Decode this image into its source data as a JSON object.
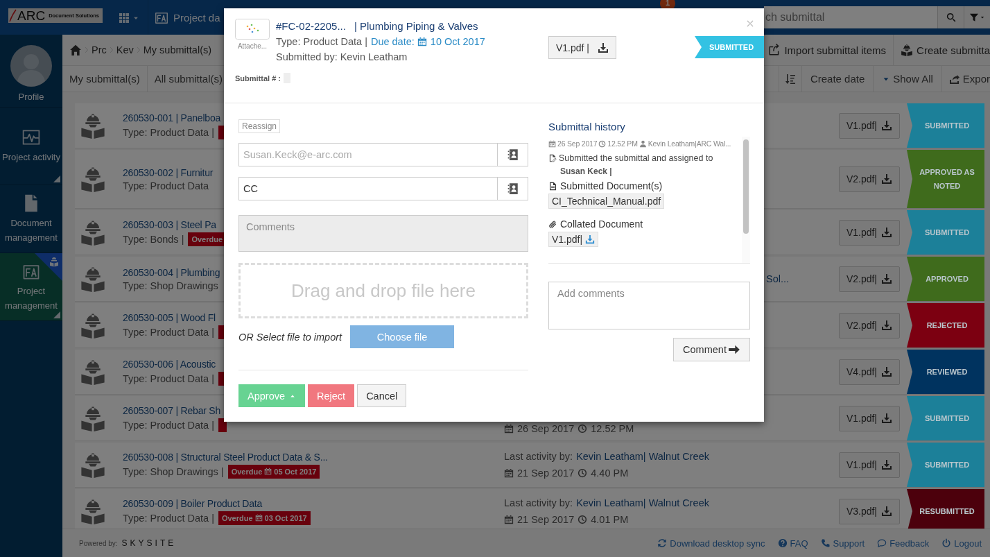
{
  "topbar": {
    "logo": {
      "mark": "ARC",
      "text": "Document Solutions"
    },
    "project_tab": "Project da",
    "notification_count": "1",
    "search": {
      "placeholder": "ch submittal"
    }
  },
  "sidebar": {
    "items": [
      {
        "kind": "profile",
        "label": "Profile",
        "selected": false,
        "expandable": false,
        "badge": false
      },
      {
        "kind": "activity",
        "label": "Project activity",
        "selected": false,
        "expandable": true,
        "badge": false
      },
      {
        "kind": "document",
        "label": "Document management",
        "selected": false,
        "expandable": false,
        "badge": false
      },
      {
        "kind": "project",
        "label": "Project management",
        "selected": true,
        "expandable": true,
        "badge": true
      }
    ]
  },
  "breadcrumb": [
    "Prc",
    "Kev",
    "My submittal(s)"
  ],
  "actions": [
    {
      "kind": "import",
      "label": "Import submittal items"
    },
    {
      "kind": "create",
      "label": "Create submitta"
    }
  ],
  "tabs": [
    {
      "label": "My submittal(s)",
      "selected": false
    },
    {
      "label": "All submittal(s)",
      "selected": false
    }
  ],
  "list_tools": {
    "sort": "Create date",
    "filter": "Show All",
    "export": "Expor"
  },
  "rows": [
    {
      "title": "260530-001 | Panelboa",
      "type": "Type: Product Data |",
      "badge": {},
      "file": "V1.pdf|",
      "status": {
        "label": "SUBMITTED",
        "color": "#1c8099"
      }
    },
    {
      "title": "260530-002 | Furnitur",
      "type": "Type: Product Data",
      "file": "V2.pdf|",
      "status": {
        "label": "APPROVED AS NOTED",
        "color": "#3f6b1c"
      }
    },
    {
      "title": "260530-003 | Steel Pa",
      "type": "Type: Bonds |",
      "badge": {
        "label": "Overdue"
      },
      "file": "V1.pdf|",
      "status": {
        "label": "SUBMITTED",
        "color": "#1c8099"
      }
    },
    {
      "title": "260530-004 | Plumbing",
      "type": "Type: Shop Drawings",
      "activity": {
        "tail": "Sol..."
      },
      "file": "V2.pdf|",
      "status": {
        "label": "APPROVED",
        "color": "#3f6b1c"
      }
    },
    {
      "title": "260530-005 | Wood Fl",
      "type": "Type: Product Data |",
      "badge": {},
      "file": "V2.pdf|",
      "status": {
        "label": "REJECTED",
        "color": "#7c0011"
      }
    },
    {
      "title": "260530-006 | Acoustic",
      "type": "Type: Product Data |",
      "badge": {},
      "file": "V4.pdf|",
      "status": {
        "label": "REVIEWED",
        "color": "#00335f"
      }
    },
    {
      "title": "260530-007 | Rebar Sh",
      "type": "Type: Product Data |",
      "badge": {},
      "activity": {
        "date": "26 Sep 2017",
        "time": "12.52 PM"
      },
      "file": "V1.pdf|",
      "status": {
        "label": "SUBMITTED",
        "color": "#1c8099"
      }
    },
    {
      "title": "260530-008 | Structural Steel Product Data & S...",
      "type": "Type: Shop Drawings |",
      "badge": {
        "label": "Overdue",
        "date": "05 Oct 2017"
      },
      "activity": {
        "label": "Last activity by:",
        "user": "Kevin Leatham| Walnut Creek",
        "date": "21 Sep 2017",
        "time": "4.40 PM"
      },
      "file": "V1.pdf|",
      "status": {
        "label": "SUBMITTED",
        "color": "#1c8099"
      }
    },
    {
      "title": "260530-009 | Boiler Product Data",
      "type": "Type: Product Data |",
      "badge": {
        "label": "Overdue",
        "date": "03 Oct 2017"
      },
      "activity": {
        "label": "Last activity by:",
        "user": "Kevin Leatham| Walnut Creek",
        "date": "21 Sep 2017",
        "time": "4.01 PM"
      },
      "file": "V3.pdf|",
      "status": {
        "label": "RESUBMITTED",
        "color": "#4c000c"
      }
    }
  ],
  "footer": {
    "powered_by": "Powered by:",
    "brand": "SKYSITE",
    "links": [
      {
        "kind": "sync",
        "label": "Download desktop sync"
      },
      {
        "kind": "faq",
        "label": "FAQ"
      },
      {
        "kind": "support",
        "label": "Support"
      },
      {
        "kind": "feedback",
        "label": "Feedback"
      },
      {
        "kind": "logout",
        "label": "Logout"
      }
    ]
  },
  "dialog": {
    "thumbnail_caption": "Attache...",
    "number": "#FC-02-2205...",
    "title": "| Plumbing Piping & Valves",
    "type": "Type: Product Data |",
    "due_label": "Due date:",
    "due_date": "10 Oct 2017",
    "submitted_by": "Submitted by: Kevin Leatham",
    "file": "V1.pdf |",
    "status": {
      "label": "SUBMITTED",
      "color": "#33c2e3"
    },
    "submittal_number_label": "Submittal # :",
    "reassign_label": "Reassign",
    "assignee": {
      "placeholder": "Susan.Keck@e-arc.com"
    },
    "cc": {
      "value": "CC"
    },
    "comments": {
      "placeholder": "Comments"
    },
    "dropzone": "Drag and drop file here",
    "select_label": "OR Select file to import",
    "choose_button": "Choose file",
    "buttons": [
      {
        "kind": "approve",
        "label": "Approve"
      },
      {
        "kind": "reject",
        "label": "Reject"
      },
      {
        "kind": "cancel",
        "label": "Cancel"
      }
    ],
    "history": {
      "title": "Submittal history",
      "entries": [
        {
          "date": "26 Sep 2017",
          "time": "12.52 PM",
          "user": "Kevin Leatham|ARC Wal...",
          "action": "Submitted the submittal and assigned to",
          "assignee": "Susan Keck |",
          "documents_label": "Submitted Document(s)",
          "documents": [
            "CI_Technical_Manual.pdf"
          ],
          "collated_label": "Collated Document",
          "collated_file": "V1.pdf|"
        }
      ]
    },
    "add_comment": {
      "placeholder": "Add comments"
    },
    "comment_button": "Comment"
  }
}
